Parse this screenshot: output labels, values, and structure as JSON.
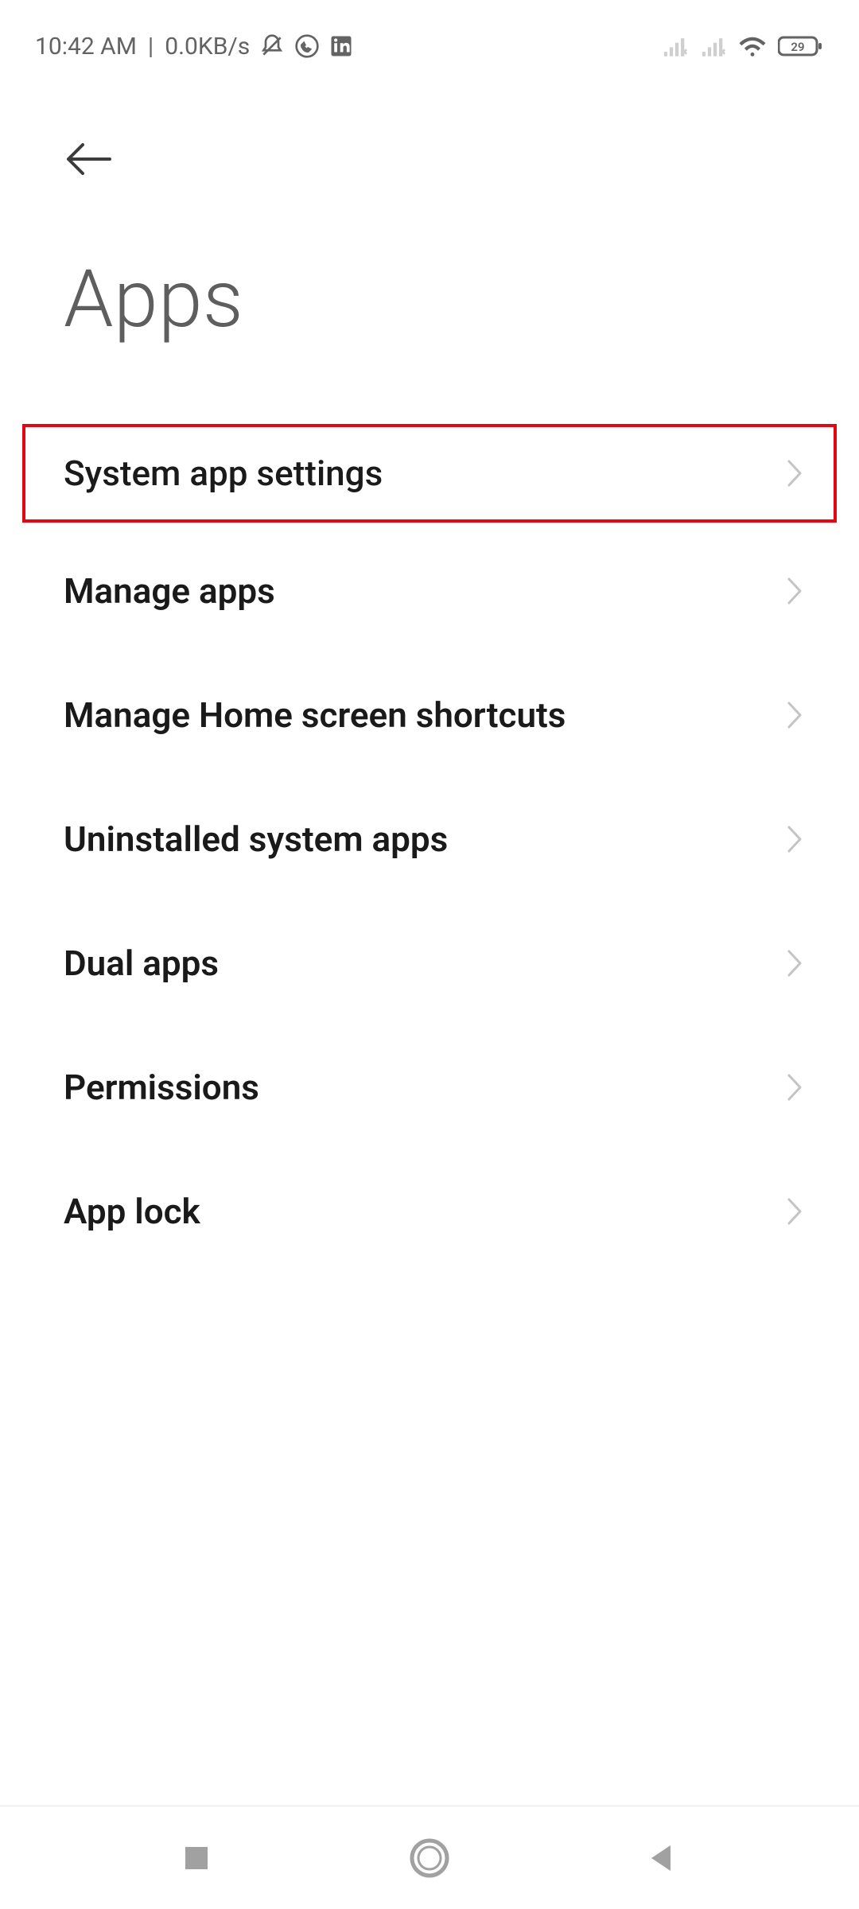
{
  "status": {
    "time": "10:42 AM",
    "network_speed": "0.0KB/s",
    "battery_level": "29"
  },
  "header": {
    "title": "Apps"
  },
  "menu": {
    "items": [
      {
        "label": "System app settings",
        "highlighted": true
      },
      {
        "label": "Manage apps",
        "highlighted": false
      },
      {
        "label": "Manage Home screen shortcuts",
        "highlighted": false
      },
      {
        "label": "Uninstalled system apps",
        "highlighted": false
      },
      {
        "label": "Dual apps",
        "highlighted": false
      },
      {
        "label": "Permissions",
        "highlighted": false
      },
      {
        "label": "App lock",
        "highlighted": false
      }
    ]
  },
  "colors": {
    "highlight_border": "#e30613",
    "text_primary": "#1a1a1a",
    "text_muted": "#5e5e5e",
    "chevron": "#bfbfbf"
  }
}
